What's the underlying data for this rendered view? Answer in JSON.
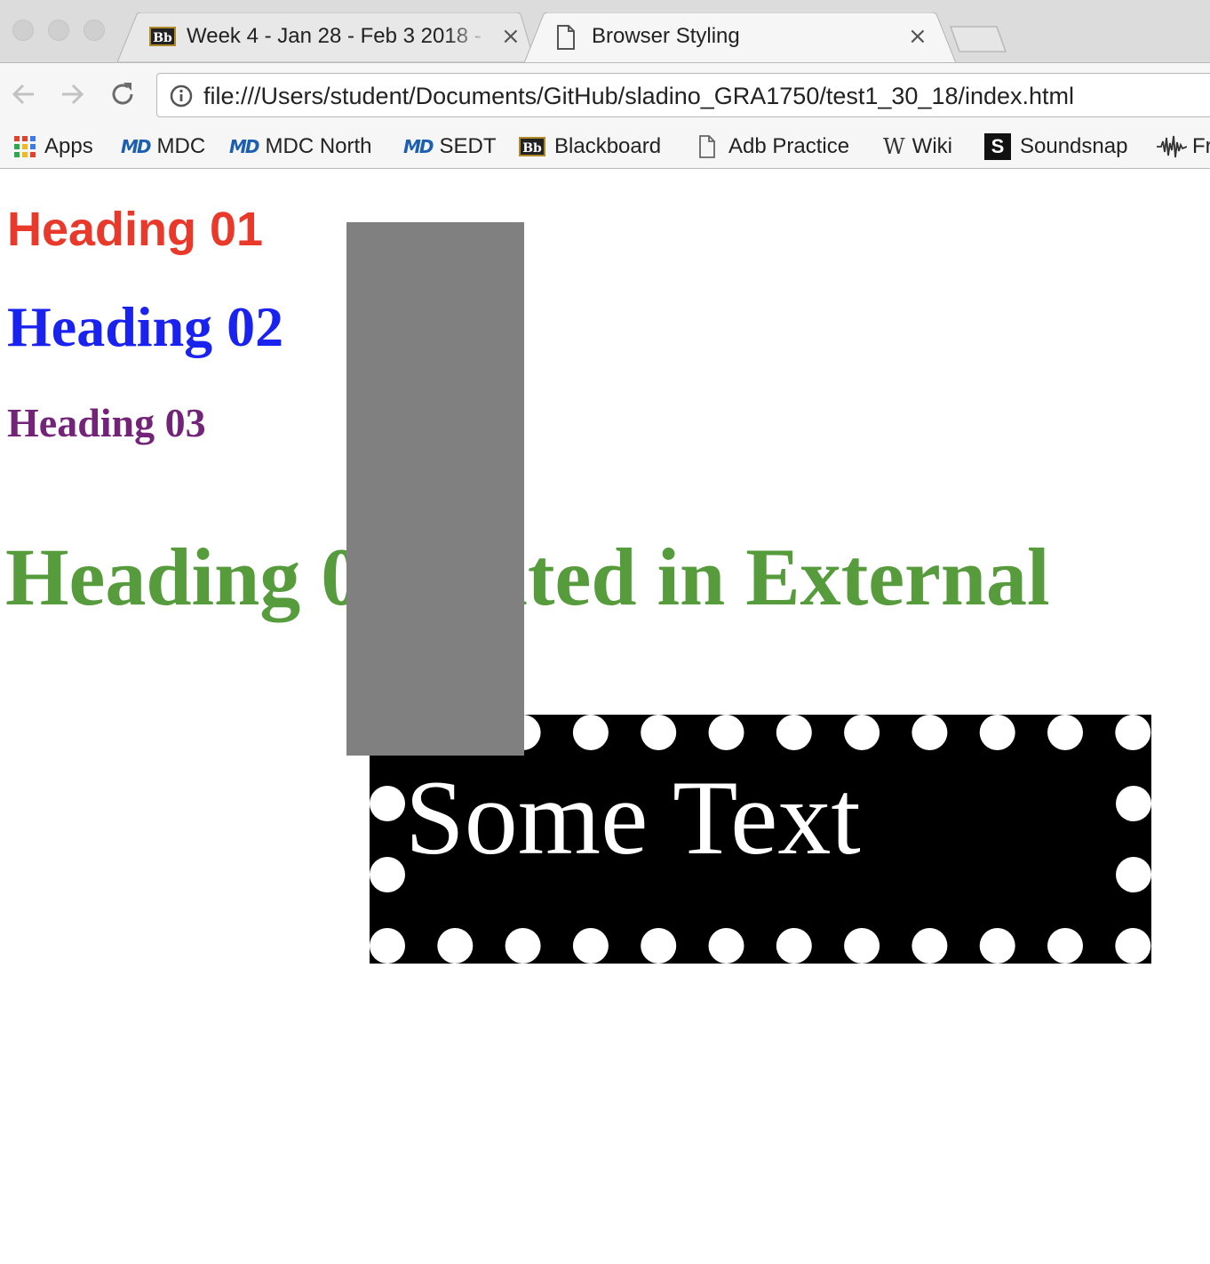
{
  "browser": {
    "tabs": [
      {
        "title": "Week 4 - Jan 28 - Feb 3 2018 - ",
        "icon": "blackboard-icon",
        "active": false
      },
      {
        "title": "Browser Styling",
        "icon": "document-icon",
        "active": true
      }
    ],
    "close_glyph": "×",
    "url": "file:///Users/student/Documents/GitHub/sladino_GRA1750/test1_30_18/index.html",
    "bookmarks": [
      {
        "label": "Apps",
        "icon": "apps-grid-icon"
      },
      {
        "label": "MDC",
        "icon": "mdc-logo-icon"
      },
      {
        "label": "MDC North",
        "icon": "mdc-logo-icon"
      },
      {
        "label": "SEDT",
        "icon": "mdc-logo-icon"
      },
      {
        "label": "Blackboard",
        "icon": "blackboard-icon"
      },
      {
        "label": "Adb Practice",
        "icon": "document-icon"
      },
      {
        "label": "Wiki",
        "icon": "wiki-logo-icon"
      },
      {
        "label": "Soundsnap",
        "icon": "soundsnap-logo-icon"
      },
      {
        "label": "Fr",
        "icon": "waveform-icon"
      }
    ],
    "logos": {
      "blackboard": "Bb",
      "mdc": "MD",
      "wiki": "W",
      "soundsnap": "S"
    }
  },
  "page": {
    "heading_01": "Heading 01",
    "heading_02": "Heading 02",
    "heading_03": "Heading 03",
    "heading_04": "Heading 04 edited in External",
    "some_text": "Some Text"
  },
  "colors": {
    "heading_01": "#e8392b",
    "heading_02": "#1a22f0",
    "heading_03": "#742478",
    "heading_04": "#569c3c",
    "gray_block": "#808080",
    "dots_background": "#000000",
    "dots": "#ffffff"
  }
}
